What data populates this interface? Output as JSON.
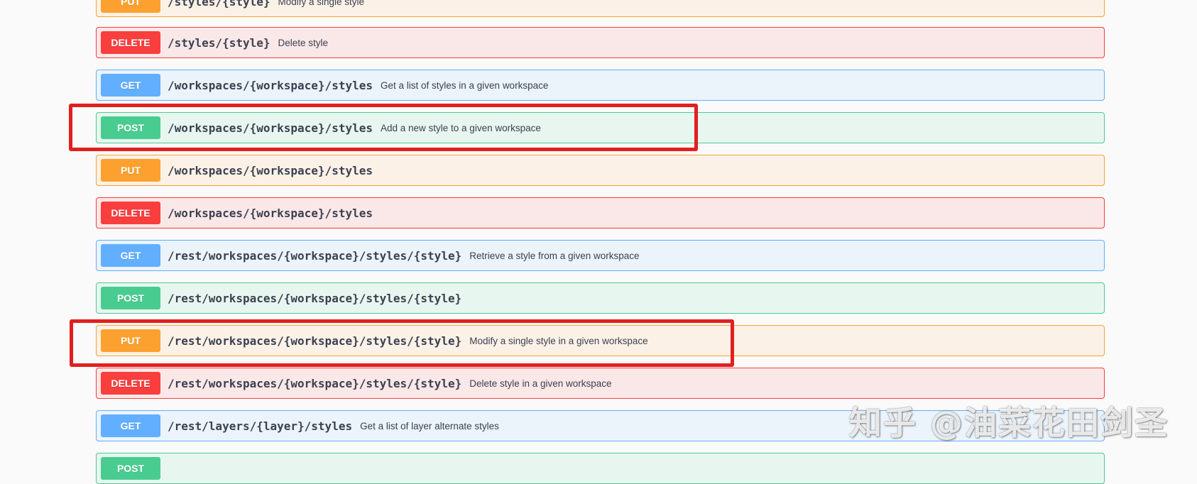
{
  "operations": [
    {
      "method": "PUT",
      "path": "/styles/{style}",
      "summary": "Modify a single style"
    },
    {
      "method": "DELETE",
      "path": "/styles/{style}",
      "summary": "Delete style"
    },
    {
      "method": "GET",
      "path": "/workspaces/{workspace}/styles",
      "summary": "Get a list of styles in a given workspace"
    },
    {
      "method": "POST",
      "path": "/workspaces/{workspace}/styles",
      "summary": "Add a new style to a given workspace"
    },
    {
      "method": "PUT",
      "path": "/workspaces/{workspace}/styles",
      "summary": ""
    },
    {
      "method": "DELETE",
      "path": "/workspaces/{workspace}/styles",
      "summary": ""
    },
    {
      "method": "GET",
      "path": "/rest/workspaces/{workspace}/styles/{style}",
      "summary": "Retrieve a style from a given workspace"
    },
    {
      "method": "POST",
      "path": "/rest/workspaces/{workspace}/styles/{style}",
      "summary": ""
    },
    {
      "method": "PUT",
      "path": "/rest/workspaces/{workspace}/styles/{style}",
      "summary": "Modify a single style in a given workspace"
    },
    {
      "method": "DELETE",
      "path": "/rest/workspaces/{workspace}/styles/{style}",
      "summary": "Delete style in a given workspace"
    },
    {
      "method": "GET",
      "path": "/rest/layers/{layer}/styles",
      "summary": "Get a list of layer alternate styles"
    },
    {
      "method": "POST",
      "path": "",
      "summary": ""
    }
  ],
  "colors": {
    "get": "#61affe",
    "post": "#49cc90",
    "put": "#fca130",
    "delete": "#f93e3e",
    "highlight": "#e0201f"
  },
  "watermark": "知乎 @油菜花田剑圣"
}
